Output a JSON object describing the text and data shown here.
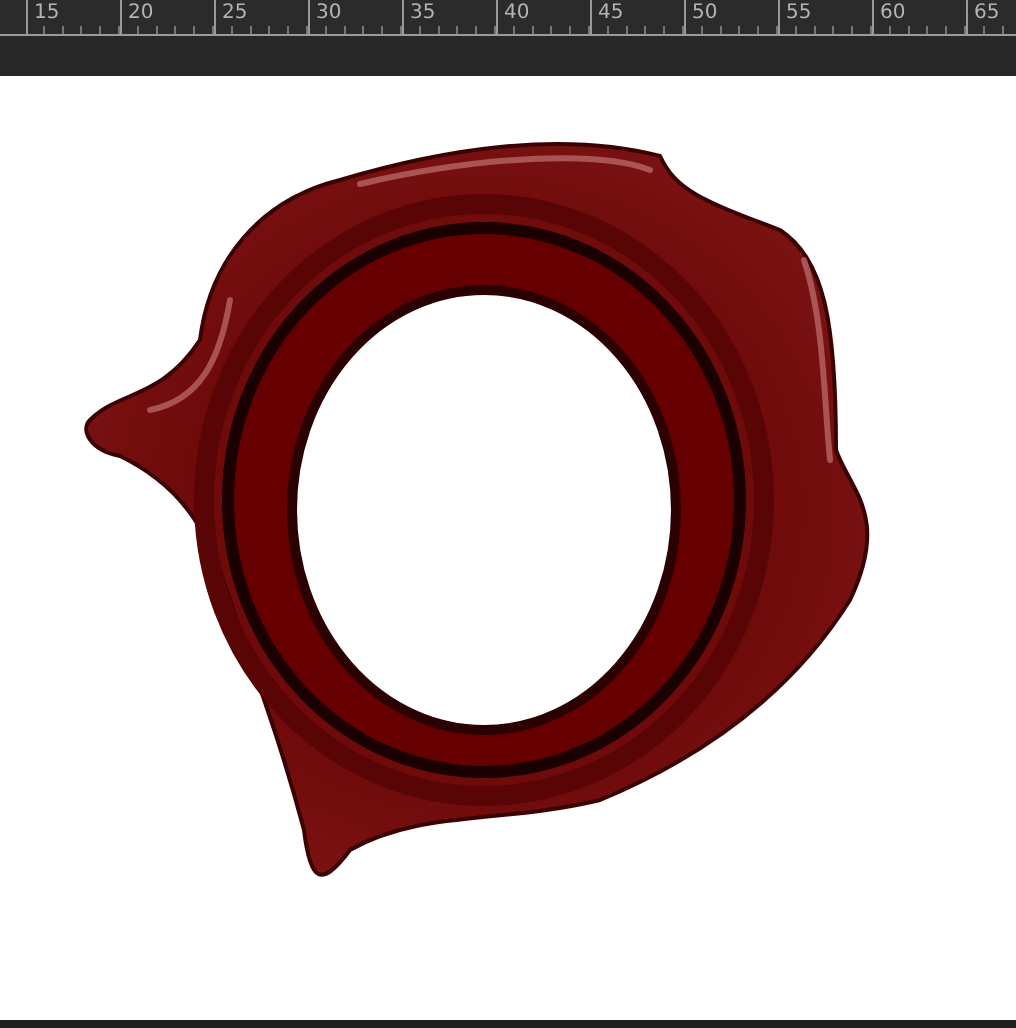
{
  "ruler": {
    "labels": [
      "15",
      "20",
      "25",
      "30",
      "35",
      "40",
      "45",
      "50",
      "55",
      "60",
      "65"
    ]
  }
}
